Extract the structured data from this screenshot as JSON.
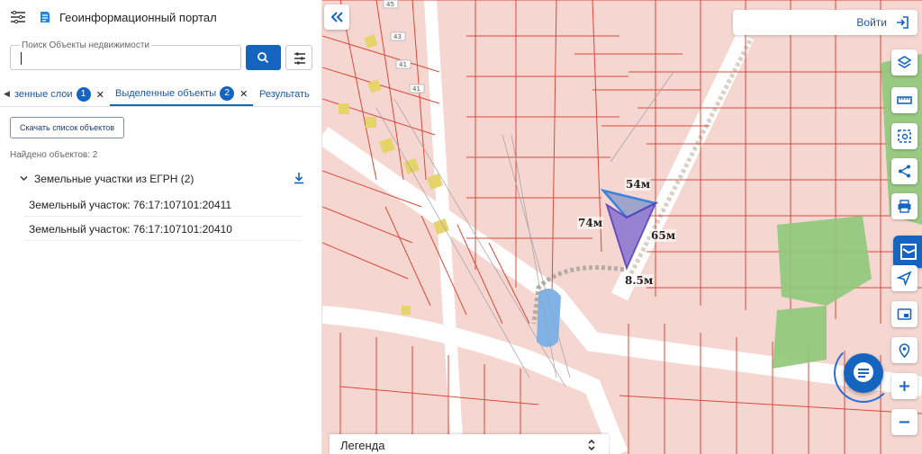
{
  "header": {
    "title": "Геоинформационный портал",
    "menu_icon": "menu-icon",
    "logo_icon": "logo-icon"
  },
  "search": {
    "label": "Поиск Объекты недвижимости",
    "value": "",
    "search_icon": "search-icon",
    "filter_icon": "filter-icon"
  },
  "tabs": [
    {
      "label": "зенные слои",
      "badge": "1"
    },
    {
      "label": "Выделенные объекты",
      "badge": "2",
      "active": true
    },
    {
      "label": "Результать"
    }
  ],
  "download_list_label": "Скачать список объектов",
  "found_text": "Найдено объектов: 2",
  "group": {
    "label": "Земельные участки из ЕГРН (2)"
  },
  "results": [
    {
      "label": "Земельный участок: 76:17:107101:20411"
    },
    {
      "label": "Земельный участок: 76:17:107101:20410"
    }
  ],
  "map": {
    "login_label": "Войти",
    "legend_label": "Легенда",
    "house_numbers": [
      "45",
      "43",
      "41",
      "41"
    ],
    "measurements": [
      "54м",
      "74м",
      "65м",
      "8.5м"
    ],
    "tools": [
      "layers-icon",
      "ruler-icon",
      "select-area-icon",
      "share-icon",
      "print-icon",
      "map-app-icon",
      "navigate-icon",
      "card-icon",
      "location-pin-icon",
      "zoom-in-icon",
      "zoom-out-icon"
    ],
    "colors": {
      "accent": "#1565c0",
      "parcel_fill": "#f6d6d0",
      "parcel_line": "#d94a3a",
      "selected_fill": "#8c7ad1",
      "green": "#8fc97a",
      "water": "#7fb3e8"
    }
  }
}
